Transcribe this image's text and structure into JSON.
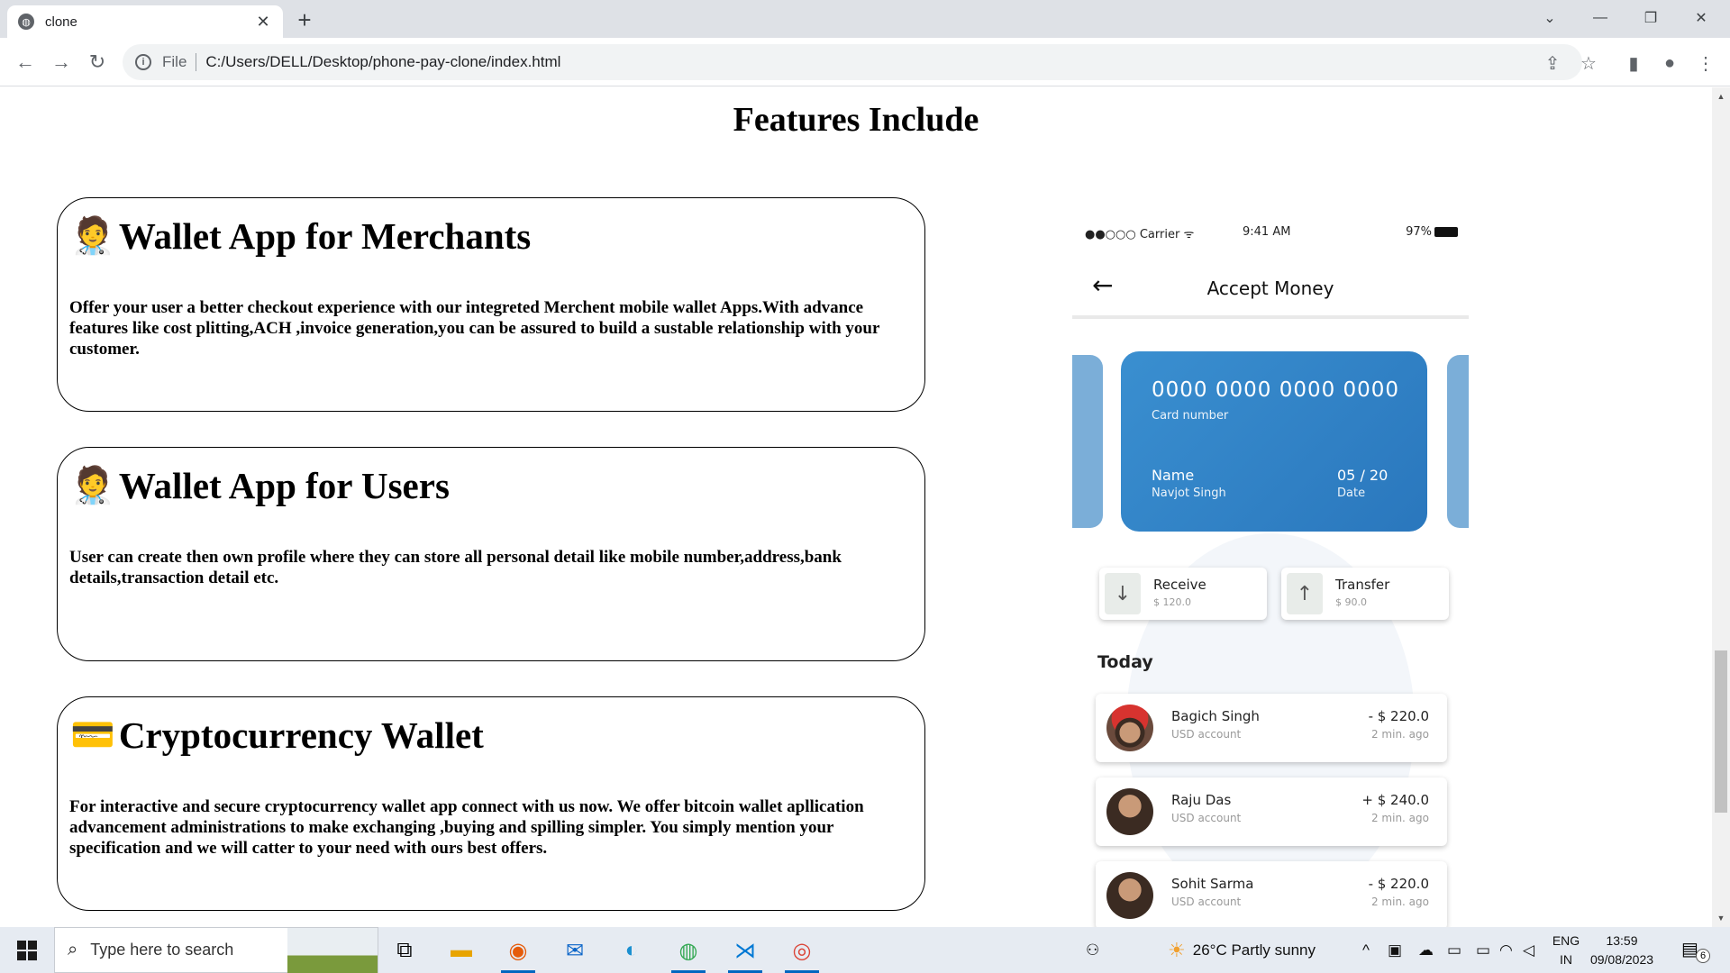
{
  "browser": {
    "tab_title": "clone",
    "tab_close": "✕",
    "new_tab": "+",
    "minimize": "—",
    "restore": "❐",
    "close": "✕",
    "chevron": "⌄",
    "omnibox_prefix": "File",
    "url": "C:/Users/DELL/Desktop/phone-pay-clone/index.html",
    "icons": [
      "back-icon",
      "forward-icon",
      "reload-icon",
      "info-icon",
      "share-icon",
      "star-icon",
      "sidepanel-icon",
      "profile-icon",
      "menu-icon"
    ]
  },
  "page": {
    "title": "Features Include",
    "cards": [
      {
        "emoji": "🧑‍⚕️",
        "heading": "Wallet App for Merchants",
        "body": "Offer your user a better checkout experience with our integreted Merchent mobile wallet Apps.With advance features like cost plitting,ACH ,invoice generation,you can be assured to build a sustable relationship with your customer."
      },
      {
        "emoji": "🧑‍⚕️",
        "heading": "Wallet App for Users",
        "body": "User can create then own profile where they can store all personal detail like mobile number,address,bank details,transaction detail etc."
      },
      {
        "emoji": "💳",
        "heading": "Cryptocurrency Wallet",
        "body": "For interactive and secure cryptocurrency wallet app connect with us now. We offer bitcoin wallet apllication advancement administrations to make exchanging ,buying and spilling simpler. You simply mention your specification and we will catter to your need with ours best offers."
      }
    ]
  },
  "phone": {
    "carrier": "●●○○○ Carrier ᯤ",
    "time": "9:41 AM",
    "battery": "97%",
    "back": "←",
    "header_title": "Accept Money",
    "card": {
      "number": "0000 0000 0000 0000",
      "number_label": "Card number",
      "name_label": "Name",
      "name": "Navjot Singh",
      "expiry": "05 / 20",
      "expiry_label": "Date"
    },
    "actions": [
      {
        "label": "Receive",
        "amount": "$ 120.0",
        "icon": "↓"
      },
      {
        "label": "Transfer",
        "amount": "$ 90.0",
        "icon": "↑"
      }
    ],
    "today_label": "Today",
    "transactions": [
      {
        "name": "Bagich Singh",
        "account": "USD account",
        "amount": "- $ 220.0",
        "ago": "2 min. ago"
      },
      {
        "name": "Raju Das",
        "account": "USD account",
        "amount": "+ $ 240.0",
        "ago": "2 min. ago"
      },
      {
        "name": "Sohit Sarma",
        "account": "USD account",
        "amount": "- $ 220.0",
        "ago": "2 min. ago"
      }
    ]
  },
  "taskbar": {
    "search_placeholder": "Type here to search",
    "weather": "26°C  Partly sunny",
    "lang_line1": "ENG",
    "lang_line2": "IN",
    "time": "13:59",
    "date": "09/08/2023",
    "notifications": "6"
  }
}
